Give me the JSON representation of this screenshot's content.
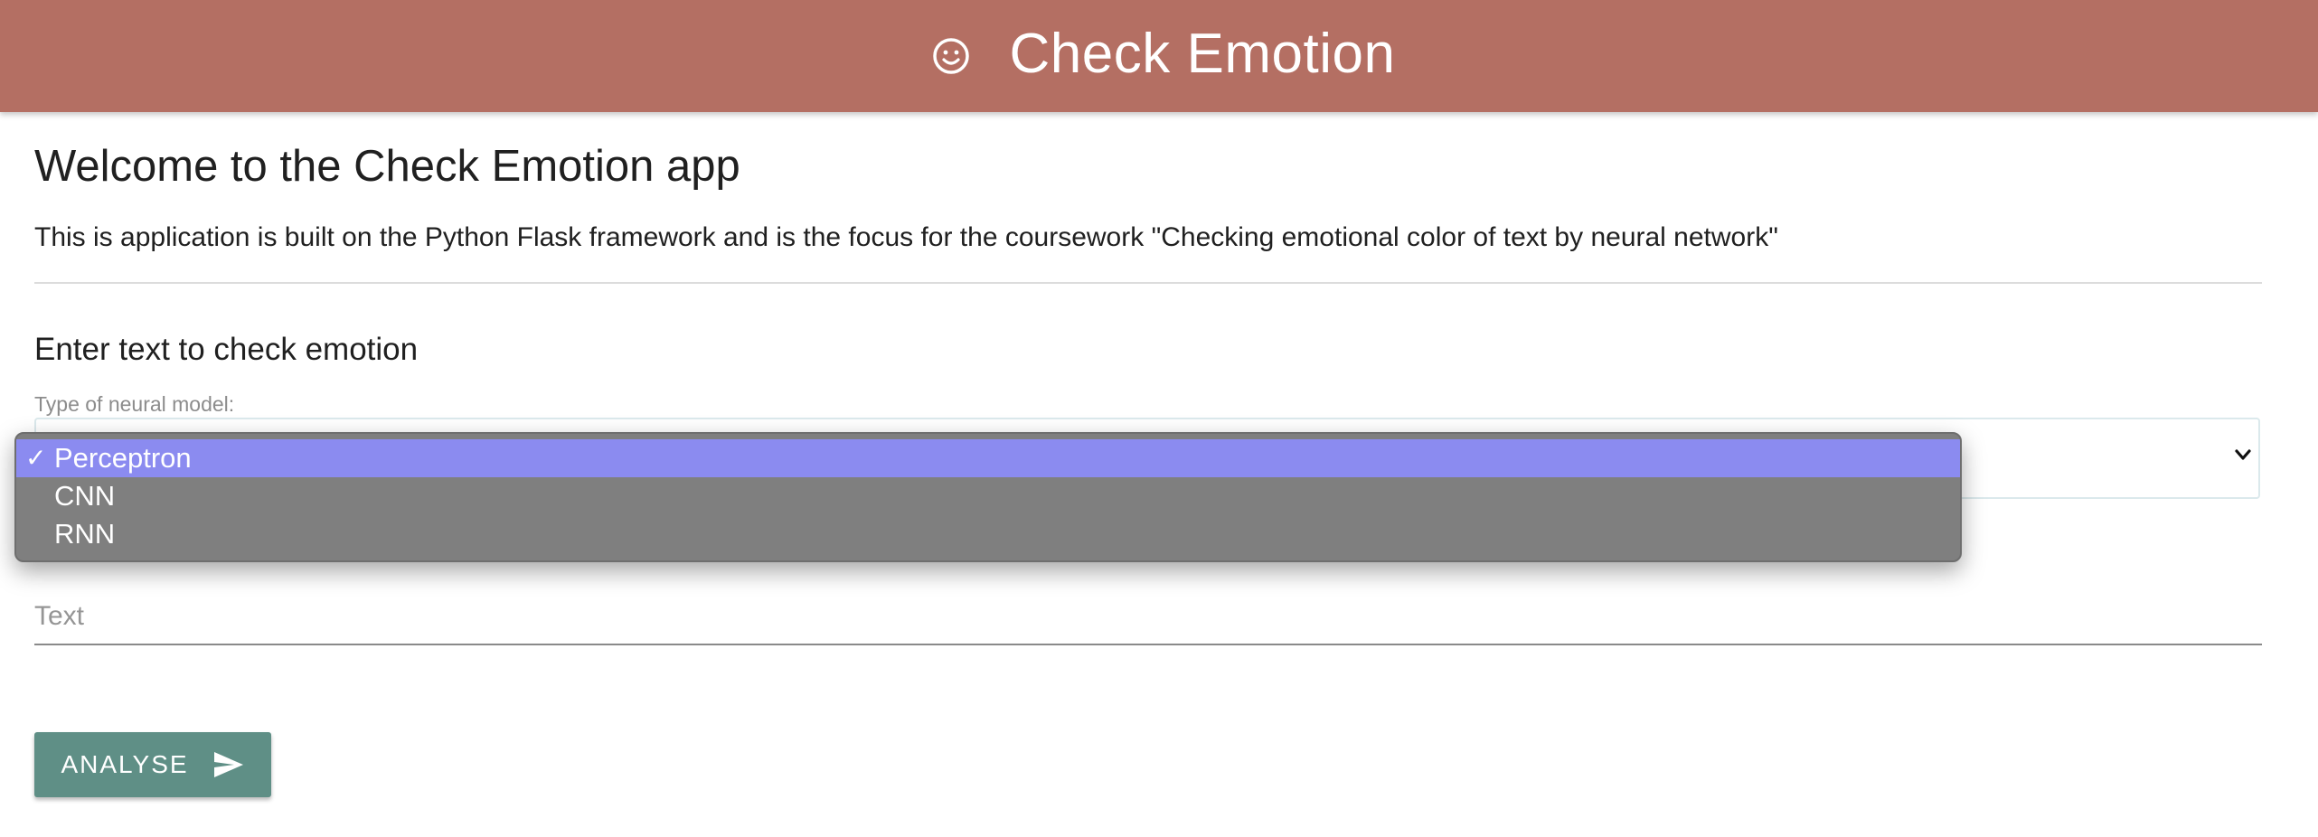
{
  "header": {
    "title": "Check Emotion",
    "icon": "smiley-face-icon",
    "background_color": "#b46f63"
  },
  "welcome": {
    "title": "Welcome to the Check Emotion app",
    "description": "This is application is built on the Python Flask framework and is the focus for the coursework \"Checking emotional color of text by neural network\""
  },
  "form": {
    "section_title": "Enter text to check emotion",
    "model_label": "Type of neural model:",
    "model_select": {
      "selected": "Perceptron",
      "options": [
        {
          "label": "Perceptron",
          "selected": true
        },
        {
          "label": "CNN",
          "selected": false
        },
        {
          "label": "RNN",
          "selected": false
        }
      ],
      "open": true
    },
    "text_placeholder": "Text",
    "text_value": "",
    "submit_label": "ANALYSE",
    "submit_icon": "send-icon",
    "submit_color": "#5f8f86"
  }
}
